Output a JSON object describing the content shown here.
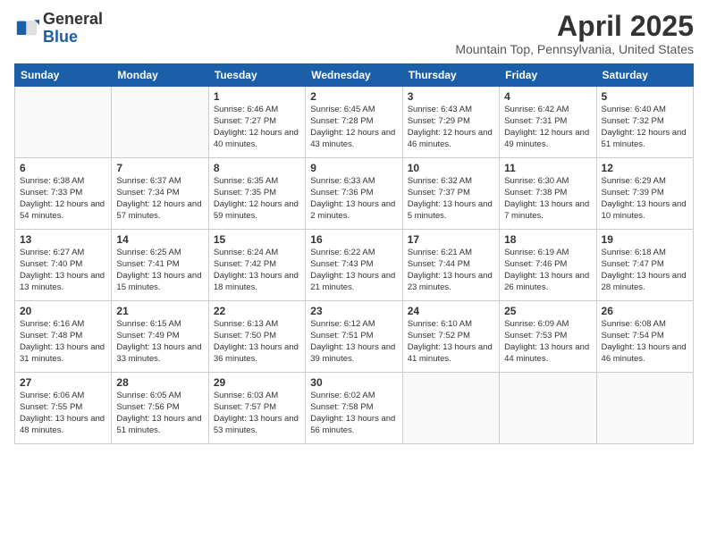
{
  "logo": {
    "general": "General",
    "blue": "Blue"
  },
  "header": {
    "title": "April 2025",
    "subtitle": "Mountain Top, Pennsylvania, United States"
  },
  "days_of_week": [
    "Sunday",
    "Monday",
    "Tuesday",
    "Wednesday",
    "Thursday",
    "Friday",
    "Saturday"
  ],
  "weeks": [
    [
      {
        "day": "",
        "info": ""
      },
      {
        "day": "",
        "info": ""
      },
      {
        "day": "1",
        "info": "Sunrise: 6:46 AM\nSunset: 7:27 PM\nDaylight: 12 hours and 40 minutes."
      },
      {
        "day": "2",
        "info": "Sunrise: 6:45 AM\nSunset: 7:28 PM\nDaylight: 12 hours and 43 minutes."
      },
      {
        "day": "3",
        "info": "Sunrise: 6:43 AM\nSunset: 7:29 PM\nDaylight: 12 hours and 46 minutes."
      },
      {
        "day": "4",
        "info": "Sunrise: 6:42 AM\nSunset: 7:31 PM\nDaylight: 12 hours and 49 minutes."
      },
      {
        "day": "5",
        "info": "Sunrise: 6:40 AM\nSunset: 7:32 PM\nDaylight: 12 hours and 51 minutes."
      }
    ],
    [
      {
        "day": "6",
        "info": "Sunrise: 6:38 AM\nSunset: 7:33 PM\nDaylight: 12 hours and 54 minutes."
      },
      {
        "day": "7",
        "info": "Sunrise: 6:37 AM\nSunset: 7:34 PM\nDaylight: 12 hours and 57 minutes."
      },
      {
        "day": "8",
        "info": "Sunrise: 6:35 AM\nSunset: 7:35 PM\nDaylight: 12 hours and 59 minutes."
      },
      {
        "day": "9",
        "info": "Sunrise: 6:33 AM\nSunset: 7:36 PM\nDaylight: 13 hours and 2 minutes."
      },
      {
        "day": "10",
        "info": "Sunrise: 6:32 AM\nSunset: 7:37 PM\nDaylight: 13 hours and 5 minutes."
      },
      {
        "day": "11",
        "info": "Sunrise: 6:30 AM\nSunset: 7:38 PM\nDaylight: 13 hours and 7 minutes."
      },
      {
        "day": "12",
        "info": "Sunrise: 6:29 AM\nSunset: 7:39 PM\nDaylight: 13 hours and 10 minutes."
      }
    ],
    [
      {
        "day": "13",
        "info": "Sunrise: 6:27 AM\nSunset: 7:40 PM\nDaylight: 13 hours and 13 minutes."
      },
      {
        "day": "14",
        "info": "Sunrise: 6:25 AM\nSunset: 7:41 PM\nDaylight: 13 hours and 15 minutes."
      },
      {
        "day": "15",
        "info": "Sunrise: 6:24 AM\nSunset: 7:42 PM\nDaylight: 13 hours and 18 minutes."
      },
      {
        "day": "16",
        "info": "Sunrise: 6:22 AM\nSunset: 7:43 PM\nDaylight: 13 hours and 21 minutes."
      },
      {
        "day": "17",
        "info": "Sunrise: 6:21 AM\nSunset: 7:44 PM\nDaylight: 13 hours and 23 minutes."
      },
      {
        "day": "18",
        "info": "Sunrise: 6:19 AM\nSunset: 7:46 PM\nDaylight: 13 hours and 26 minutes."
      },
      {
        "day": "19",
        "info": "Sunrise: 6:18 AM\nSunset: 7:47 PM\nDaylight: 13 hours and 28 minutes."
      }
    ],
    [
      {
        "day": "20",
        "info": "Sunrise: 6:16 AM\nSunset: 7:48 PM\nDaylight: 13 hours and 31 minutes."
      },
      {
        "day": "21",
        "info": "Sunrise: 6:15 AM\nSunset: 7:49 PM\nDaylight: 13 hours and 33 minutes."
      },
      {
        "day": "22",
        "info": "Sunrise: 6:13 AM\nSunset: 7:50 PM\nDaylight: 13 hours and 36 minutes."
      },
      {
        "day": "23",
        "info": "Sunrise: 6:12 AM\nSunset: 7:51 PM\nDaylight: 13 hours and 39 minutes."
      },
      {
        "day": "24",
        "info": "Sunrise: 6:10 AM\nSunset: 7:52 PM\nDaylight: 13 hours and 41 minutes."
      },
      {
        "day": "25",
        "info": "Sunrise: 6:09 AM\nSunset: 7:53 PM\nDaylight: 13 hours and 44 minutes."
      },
      {
        "day": "26",
        "info": "Sunrise: 6:08 AM\nSunset: 7:54 PM\nDaylight: 13 hours and 46 minutes."
      }
    ],
    [
      {
        "day": "27",
        "info": "Sunrise: 6:06 AM\nSunset: 7:55 PM\nDaylight: 13 hours and 48 minutes."
      },
      {
        "day": "28",
        "info": "Sunrise: 6:05 AM\nSunset: 7:56 PM\nDaylight: 13 hours and 51 minutes."
      },
      {
        "day": "29",
        "info": "Sunrise: 6:03 AM\nSunset: 7:57 PM\nDaylight: 13 hours and 53 minutes."
      },
      {
        "day": "30",
        "info": "Sunrise: 6:02 AM\nSunset: 7:58 PM\nDaylight: 13 hours and 56 minutes."
      },
      {
        "day": "",
        "info": ""
      },
      {
        "day": "",
        "info": ""
      },
      {
        "day": "",
        "info": ""
      }
    ]
  ]
}
